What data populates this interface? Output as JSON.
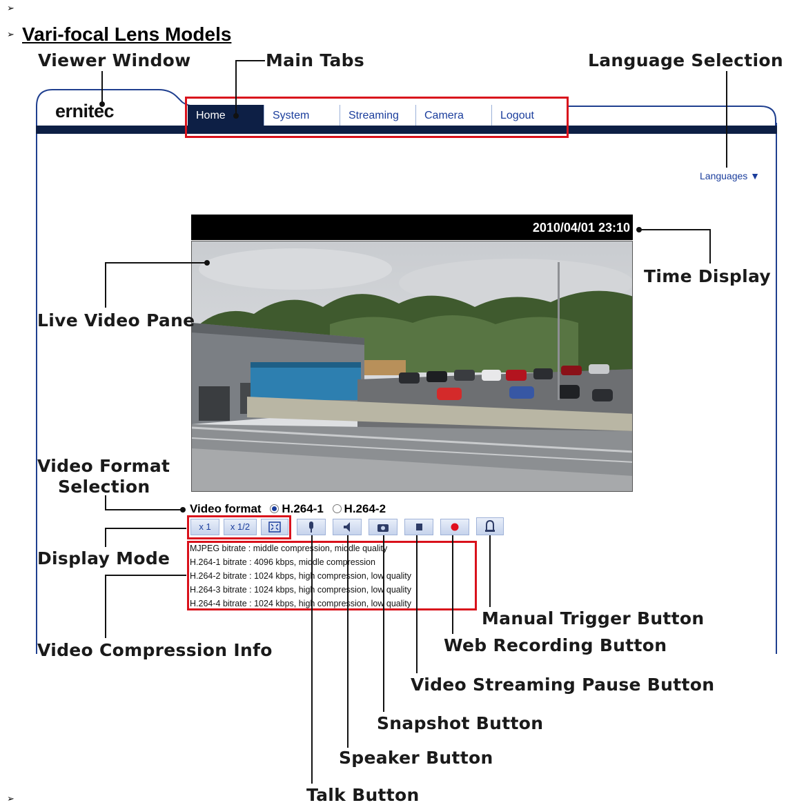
{
  "document": {
    "heading": "Vari-focal Lens Models",
    "bullet": "➢"
  },
  "callouts": {
    "viewer_window": "Viewer Window",
    "main_tabs": "Main Tabs",
    "language_selection": "Language Selection",
    "time_display": "Time Display",
    "live_video_pane": "Live Video Pane",
    "video_format_selection_1": "Video Format",
    "video_format_selection_2": "Selection",
    "display_mode": "Display Mode",
    "video_compression_info": "Video Compression Info",
    "manual_trigger_button": "Manual  Trigger  Button",
    "web_recording_button": "Web Recording Button",
    "video_streaming_pause_button": "Video Streaming Pause Button",
    "snapshot_button": "Snapshot Button",
    "speaker_button": "Speaker Button",
    "talk_button": "Talk Button"
  },
  "viewer": {
    "logo": "ernitec",
    "tabs": [
      {
        "label": "Home",
        "active": true
      },
      {
        "label": "System",
        "active": false
      },
      {
        "label": "Streaming",
        "active": false
      },
      {
        "label": "Camera",
        "active": false
      },
      {
        "label": "Logout",
        "active": false
      }
    ],
    "languages_label": "Languages ▼",
    "timestamp": "2010/04/01 23:10",
    "video_format": {
      "label": "Video format",
      "options": [
        {
          "label": "H.264-1",
          "selected": true
        },
        {
          "label": "H.264-2",
          "selected": false
        }
      ]
    },
    "display_mode_buttons": [
      "x 1",
      "x 1/2"
    ],
    "compression_info": [
      "MJPEG bitrate : middle compression, middle quality",
      "H.264-1 bitrate : 4096 kbps, middle compression",
      "H.264-2 bitrate : 1024 kbps, high compression, low quality",
      "H.264-3 bitrate : 1024 kbps, high compression, low quality",
      "H.264-4 bitrate : 1024 kbps, high compression, low quality"
    ]
  },
  "colors": {
    "navy": "#0d1f45",
    "link_blue": "#1a3d9c",
    "highlight_red": "#d9111b",
    "record_red": "#e0101e"
  }
}
